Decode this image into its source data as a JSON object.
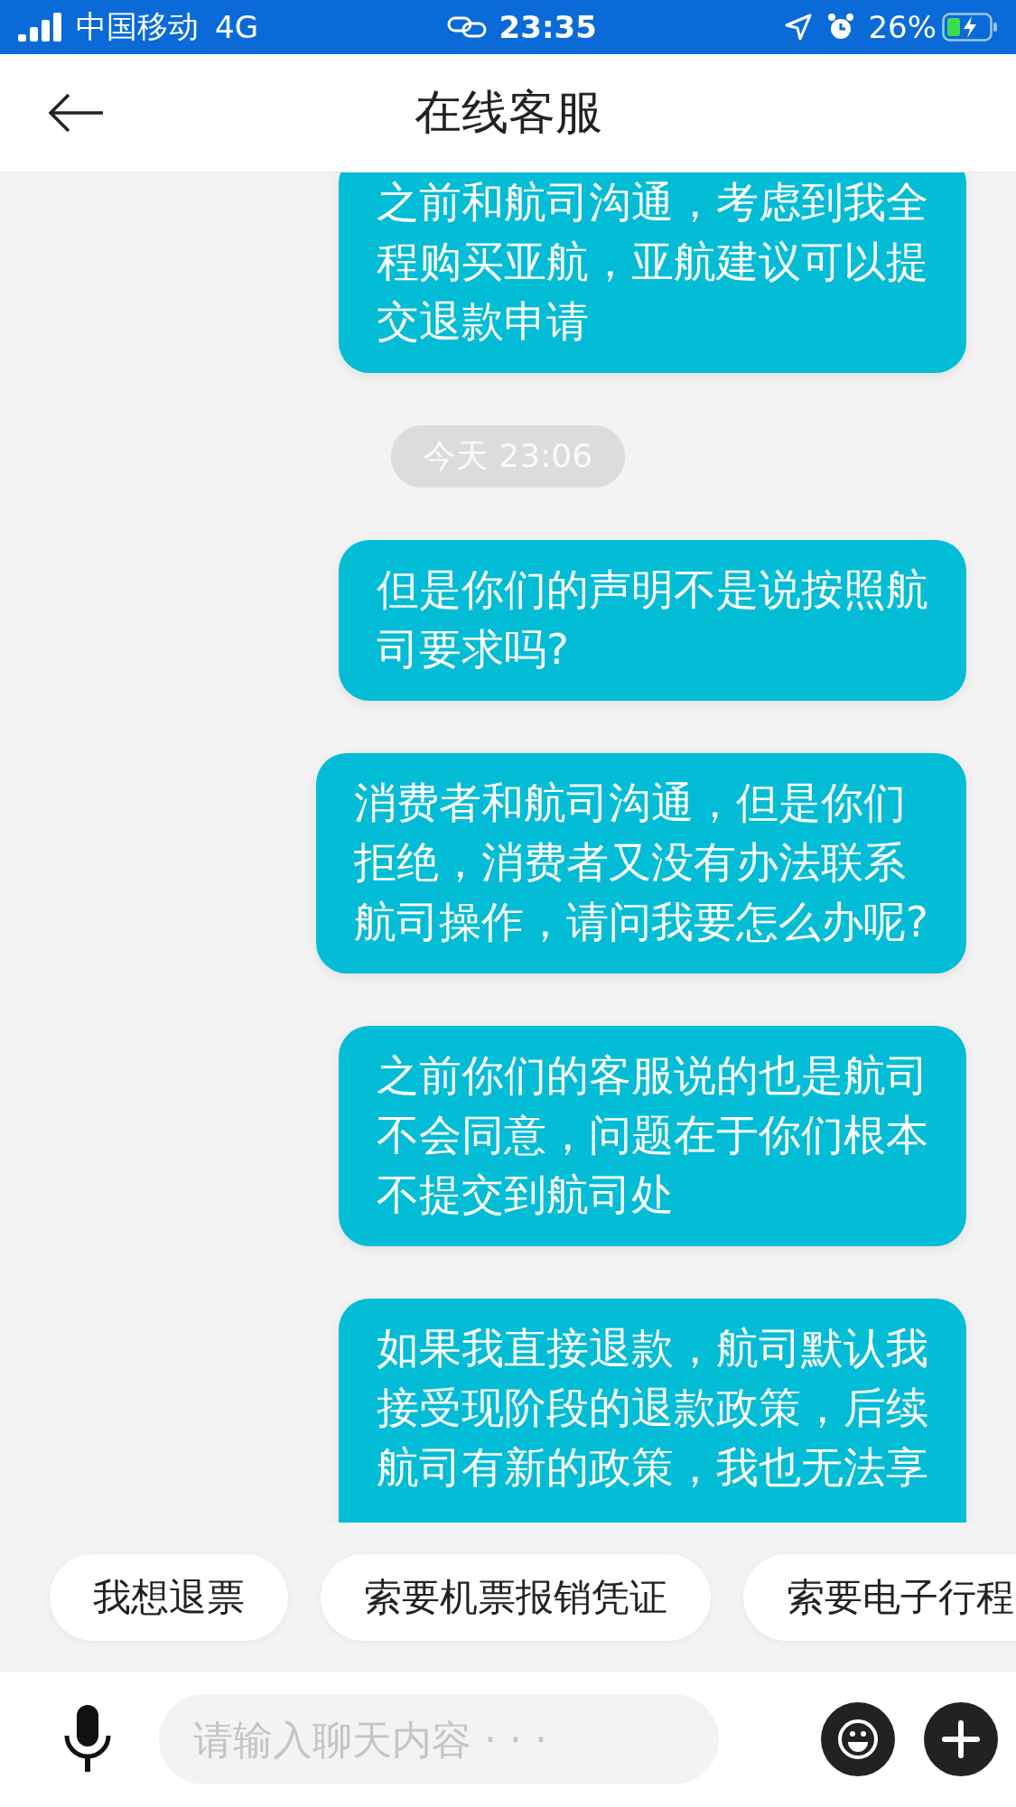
{
  "status_bar": {
    "carrier": "中国移动",
    "network": "4G",
    "time": "23:35",
    "battery": "26%"
  },
  "header": {
    "title": "在线客服"
  },
  "messages": [
    {
      "kind": "bubble",
      "lines": [
        "之前和航司沟通，考虑到我全",
        "程购买亚航，亚航建议可以提",
        "交退款申请"
      ]
    },
    {
      "kind": "timestamp",
      "text": "今天 23:06"
    },
    {
      "kind": "bubble",
      "lines": [
        "但是你们的声明不是说按照航",
        "司要求吗?"
      ]
    },
    {
      "kind": "bubble",
      "lines": [
        "消费者和航司沟通，但是你们",
        "拒绝，消费者又没有办法联系",
        "航司操作，请问我要怎么办呢?"
      ]
    },
    {
      "kind": "bubble",
      "lines": [
        "之前你们的客服说的也是航司",
        "不会同意，问题在于你们根本",
        "不提交到航司处"
      ]
    },
    {
      "kind": "bubble",
      "lines": [
        "如果我直接退款，航司默认我",
        "接受现阶段的退款政策，后续",
        "航司有新的政策，我也无法享"
      ]
    }
  ],
  "quick_replies": [
    "我想退票",
    "索要机票报销凭证",
    "索要电子行程"
  ],
  "input": {
    "placeholder": "请输入聊天内容 · · ·"
  }
}
